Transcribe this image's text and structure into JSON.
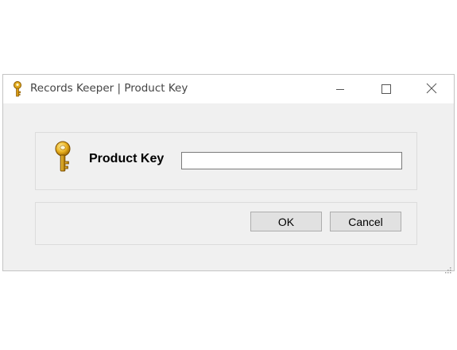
{
  "window": {
    "title": "Records Keeper | Product Key"
  },
  "titlebar_buttons": {
    "minimize_icon": "minimize-icon",
    "maximize_icon": "maximize-icon",
    "close_icon": "close-icon"
  },
  "form": {
    "icon": "key-icon",
    "label": "Product Key",
    "input_value": "",
    "input_placeholder": ""
  },
  "buttons": {
    "ok_label": "OK",
    "cancel_label": "Cancel"
  },
  "colors": {
    "window_bg": "#f0f0f0",
    "titlebar_bg": "#ffffff",
    "key_gold": "#d4a017"
  }
}
